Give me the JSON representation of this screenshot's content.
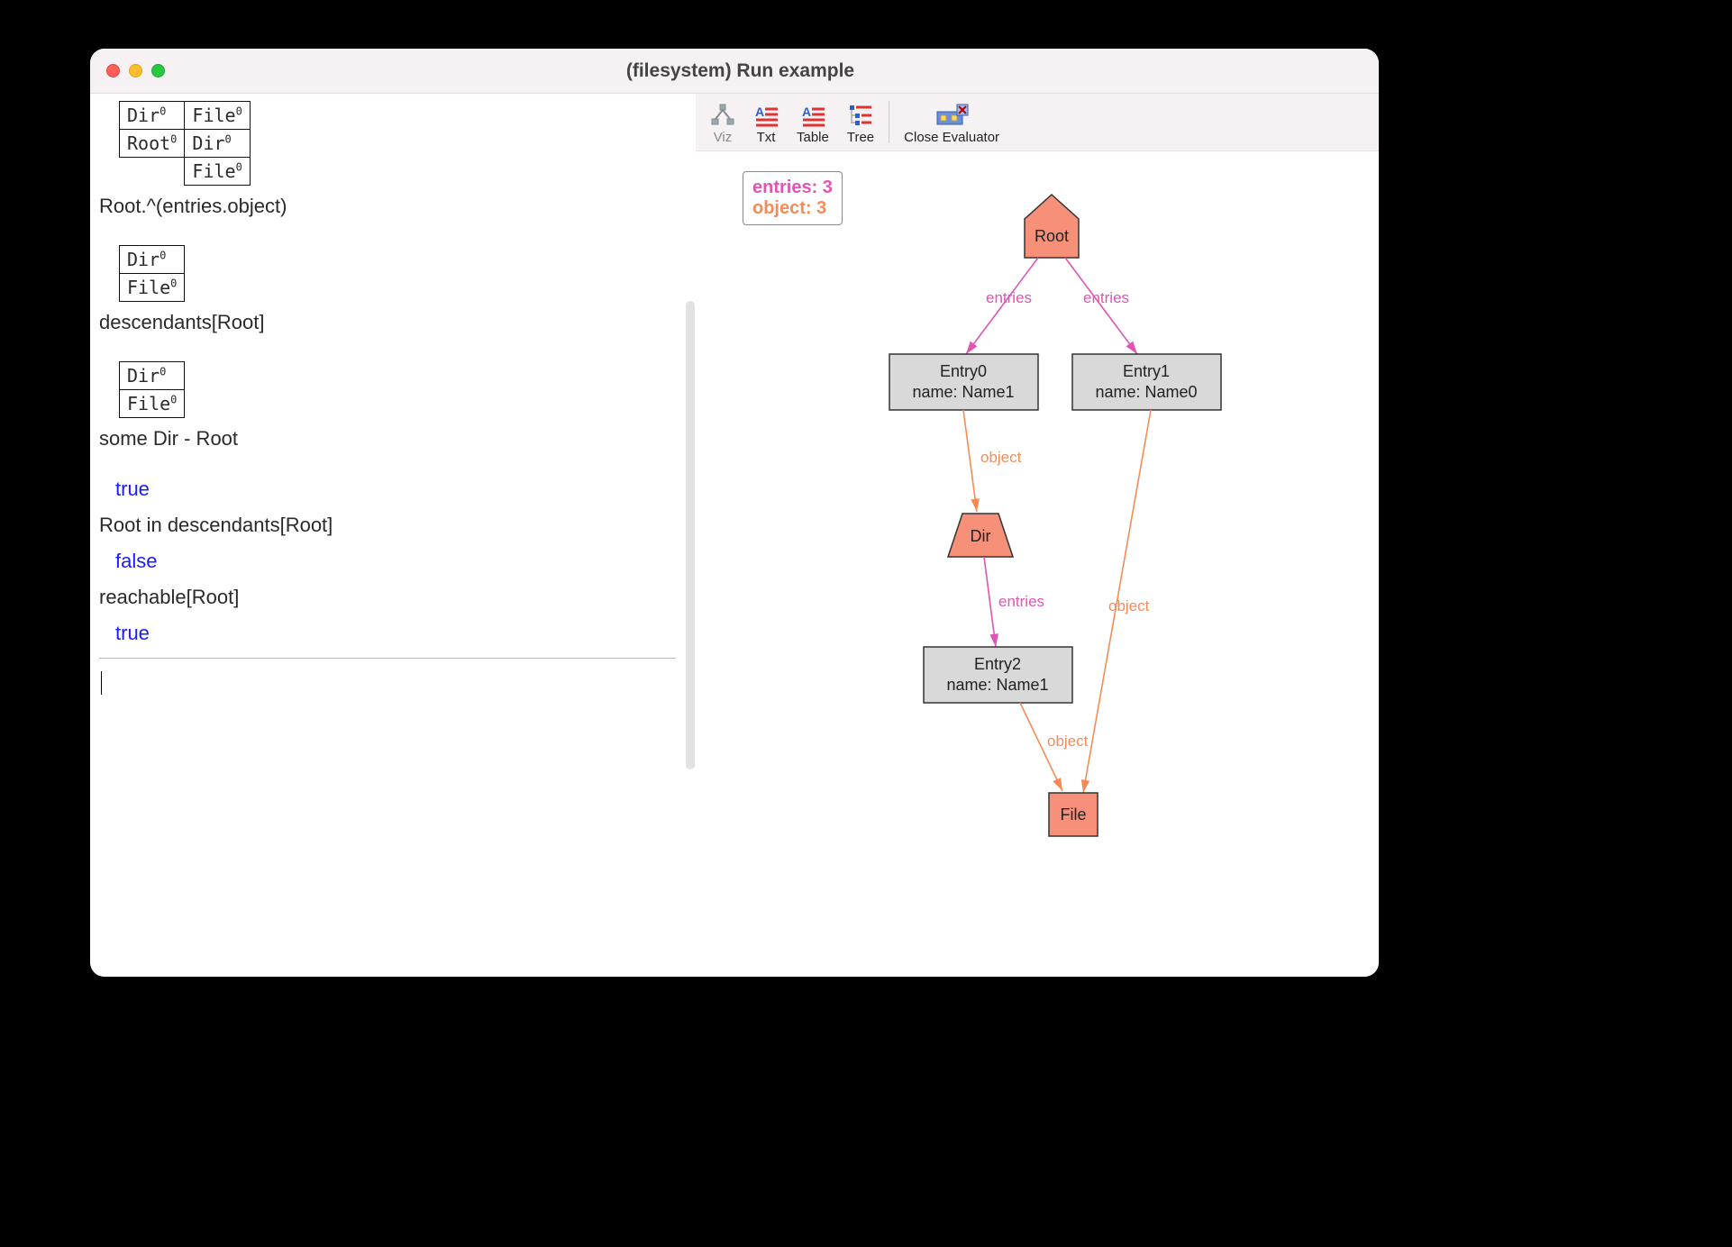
{
  "window": {
    "title": "(filesystem) Run example"
  },
  "toolbar": {
    "viz": "Viz",
    "txt": "Txt",
    "table": "Table",
    "tree": "Tree",
    "close": "Close Evaluator"
  },
  "legend": {
    "entries": "entries: 3",
    "object": "object: 3"
  },
  "left": {
    "t1": {
      "r1c1": "Dir",
      "r1c2": "File",
      "r2c1": "Root",
      "r2c2": "Dir",
      "r3c2": "File"
    },
    "e1": "Root.^(entries.object)",
    "t2": {
      "r1": "Dir",
      "r2": "File"
    },
    "e2": "descendants[Root]",
    "t3": {
      "r1": "Dir",
      "r2": "File"
    },
    "e3": "some Dir - Root",
    "b1": "true",
    "e4": "Root in descendants[Root]",
    "b2": "false",
    "e5": "reachable[Root]",
    "b3": "true"
  },
  "graph": {
    "root": "Root",
    "entry0_l1": "Entry0",
    "entry0_l2": "name: Name1",
    "entry1_l1": "Entry1",
    "entry1_l2": "name: Name0",
    "dir": "Dir",
    "entry2_l1": "Entry2",
    "entry2_l2": "name: Name1",
    "file": "File",
    "edge_entries": "entries",
    "edge_object": "object"
  },
  "chart_data": {
    "type": "table",
    "title": "(filesystem) Run example — instance graph",
    "nodes": [
      {
        "id": "Root",
        "kind": "dir-root"
      },
      {
        "id": "Entry0",
        "kind": "entry",
        "name": "Name1"
      },
      {
        "id": "Entry1",
        "kind": "entry",
        "name": "Name0"
      },
      {
        "id": "Dir",
        "kind": "dir"
      },
      {
        "id": "Entry2",
        "kind": "entry",
        "name": "Name1"
      },
      {
        "id": "File",
        "kind": "file"
      }
    ],
    "edges": [
      {
        "from": "Root",
        "to": "Entry0",
        "label": "entries"
      },
      {
        "from": "Root",
        "to": "Entry1",
        "label": "entries"
      },
      {
        "from": "Entry0",
        "to": "Dir",
        "label": "object"
      },
      {
        "from": "Dir",
        "to": "Entry2",
        "label": "entries"
      },
      {
        "from": "Entry2",
        "to": "File",
        "label": "object"
      },
      {
        "from": "Entry1",
        "to": "File",
        "label": "object"
      }
    ]
  }
}
